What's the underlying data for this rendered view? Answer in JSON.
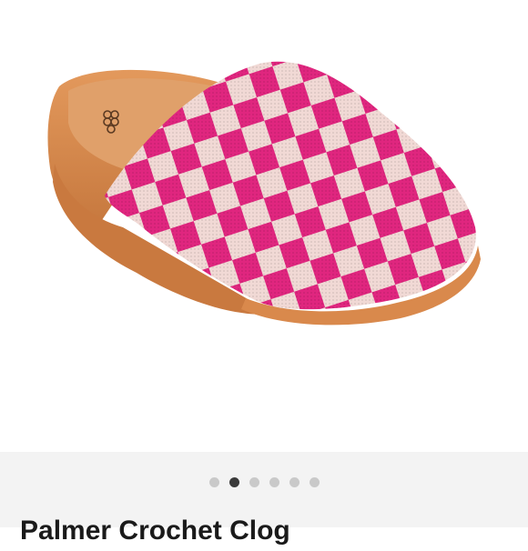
{
  "carousel": {
    "image_alt": "Pink and cream checkered crochet mule with tan footbed",
    "slide_count": 6,
    "active_index": 1
  },
  "listing": {
    "title": "Palmer Crochet Clog"
  },
  "colors": {
    "pink": "#e0267f",
    "cream": "#f1d9d5",
    "sole": "#d9894c",
    "dot_active": "#3a3a3a",
    "dot_inactive": "#c9c9c9"
  }
}
